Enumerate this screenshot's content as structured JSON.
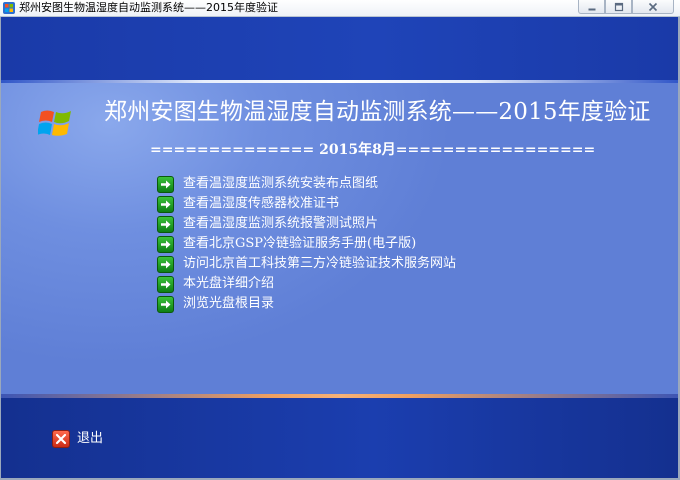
{
  "window": {
    "title": "郑州安图生物温湿度自动监测系统——2015年度验证",
    "app_icon": "app-icon",
    "controls": [
      "minimize-icon",
      "maximize-icon",
      "close-icon"
    ]
  },
  "header": {
    "logo_icon": "windows-flag-logo",
    "title": "郑州安图生物温湿度自动监测系统——2015年度验证",
    "date_line": "============== 2015年8月================="
  },
  "menu": {
    "item_icon": "green-arrow-icon",
    "items": [
      {
        "label": "查看温湿度监测系统安装布点图纸"
      },
      {
        "label": "查看温湿度传感器校准证书"
      },
      {
        "label": "查看温湿度监测系统报警测试照片"
      },
      {
        "label": "查看北京GSP冷链验证服务手册(电子版)"
      },
      {
        "label": "访问北京首工科技第三方冷链验证技术服务网站"
      },
      {
        "label": "本光盘详细介绍"
      },
      {
        "label": "浏览光盘根目录"
      }
    ]
  },
  "footer": {
    "exit_label": "退出",
    "exit_icon": "red-x-icon"
  },
  "colors": {
    "top_band": "#1f44b8",
    "middle_panel": "#6f8fe0",
    "bottom_band": "#1b3eaf",
    "accent_line": "#f6b277",
    "arrow_green": "#1fa024",
    "exit_red": "#e0391f"
  }
}
